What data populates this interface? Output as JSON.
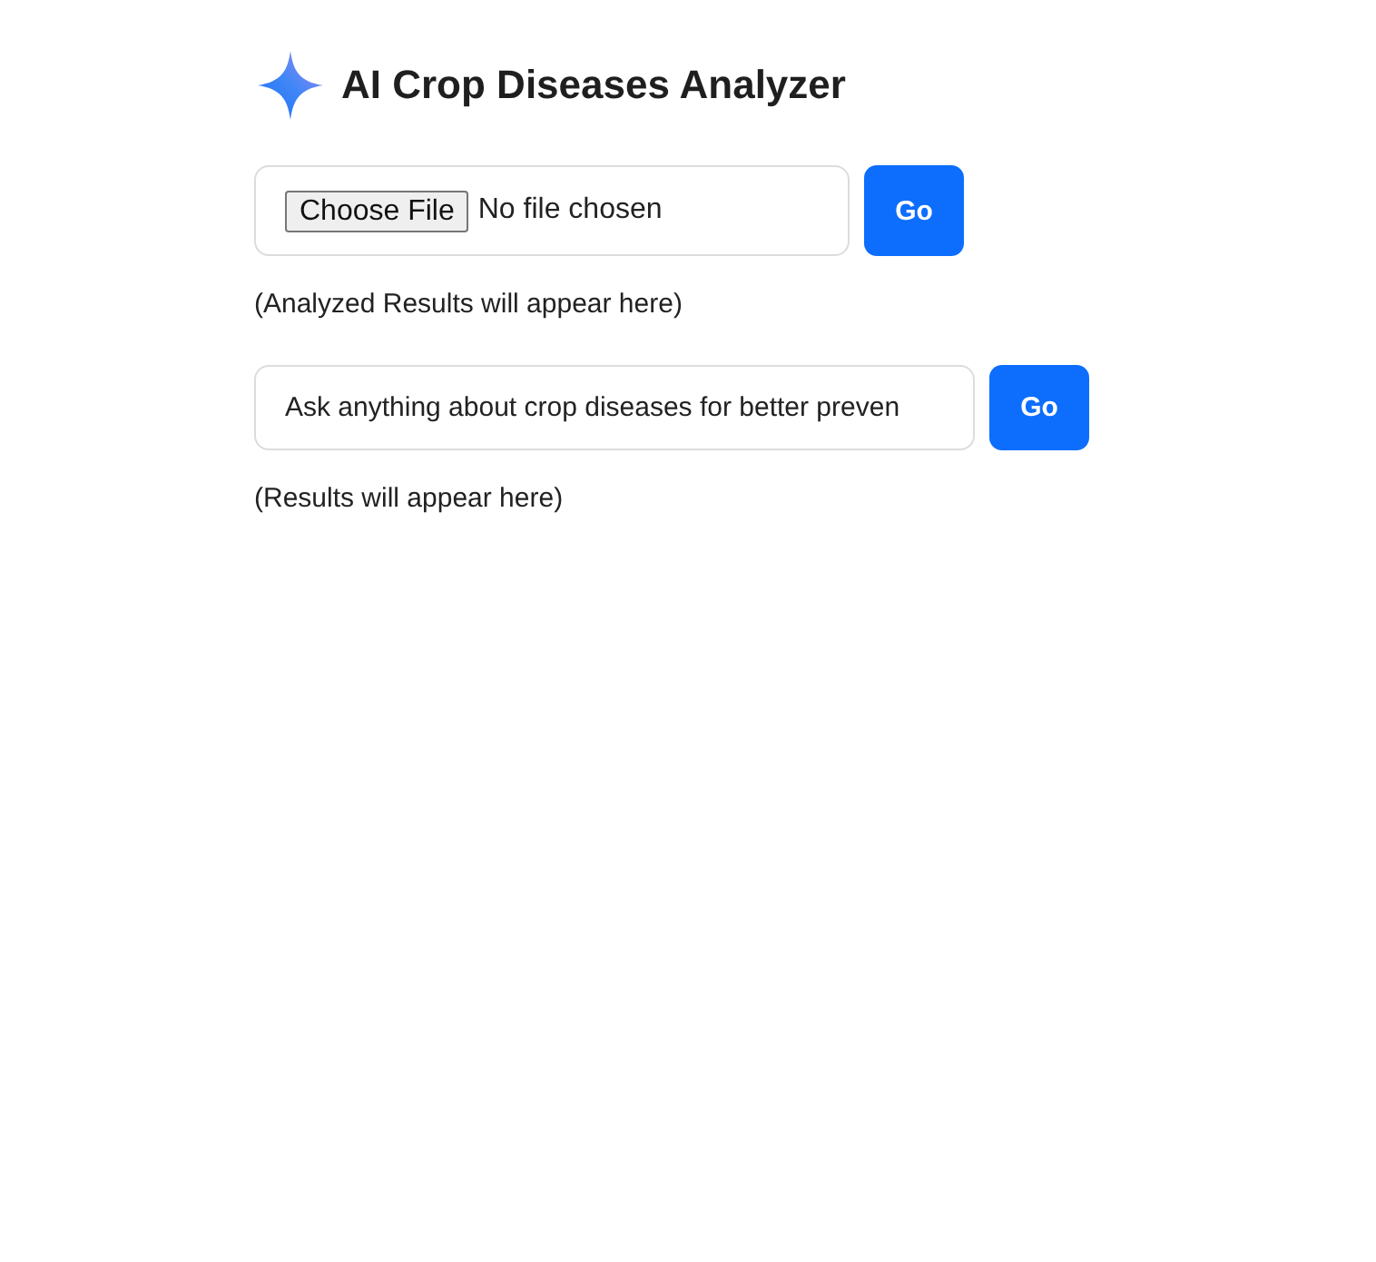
{
  "header": {
    "title": "AI Crop Diseases Analyzer"
  },
  "image_analyzer": {
    "file_button": "Choose File",
    "file_status": "No file chosen",
    "submit": "Go",
    "result": "(Analyzed Results will appear here)"
  },
  "question": {
    "value": "Ask anything about crop diseases for better preven",
    "submit": "Go",
    "result": "(Results will appear here)"
  }
}
